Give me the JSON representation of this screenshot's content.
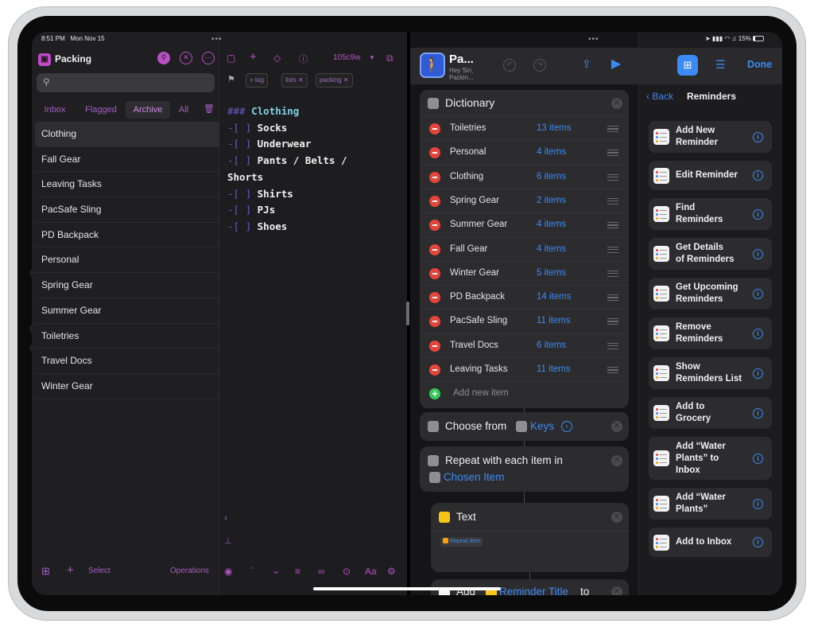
{
  "status": {
    "time": "8:51 PM",
    "date": "Mon Nov 15",
    "battery": "15%"
  },
  "drafts": {
    "workspace_title": "Packing",
    "search": {
      "placeholder": ""
    },
    "tabs": [
      {
        "label": "Inbox",
        "active": false
      },
      {
        "label": "Flagged",
        "active": false
      },
      {
        "label": "Archive",
        "active": true
      },
      {
        "label": "All",
        "active": false
      }
    ],
    "list_items": [
      "Clothing",
      "Fall Gear",
      "Leaving Tasks",
      "PacSafe Sling",
      "PD Backpack",
      "Personal",
      "Spring Gear",
      "Summer Gear",
      "Toiletries",
      "Travel Docs",
      "Winter Gear"
    ],
    "footer": {
      "select": "Select",
      "operations": "Operations"
    },
    "editor": {
      "version": "105c9w",
      "tags": {
        "add": "+ tag",
        "lists": "lists ✕",
        "packing": "packing ✕"
      },
      "heading_marker": "###",
      "heading": "Clothing",
      "checkbox": "[ ]",
      "items": [
        "Socks",
        "Underwear",
        "Pants / Belts /",
        "Shirts",
        "PJs",
        "Shoes"
      ],
      "continuation": "Shorts",
      "font_label": "Aa"
    }
  },
  "shortcuts": {
    "name": "Pa...",
    "subtitle_line1": "Hey Siri,",
    "subtitle_line2": "Packin...",
    "dictionary": {
      "title": "Dictionary",
      "rows": [
        {
          "key": "Toiletries",
          "value": "13 items"
        },
        {
          "key": "Personal",
          "value": "4 items"
        },
        {
          "key": "Clothing",
          "value": "6 items"
        },
        {
          "key": "Spring Gear",
          "value": "2 items"
        },
        {
          "key": "Summer Gear",
          "value": "4 items"
        },
        {
          "key": "Fall Gear",
          "value": "4 items"
        },
        {
          "key": "Winter Gear",
          "value": "5 items"
        },
        {
          "key": "PD Backpack",
          "value": "14 items"
        },
        {
          "key": "PacSafe Sling",
          "value": "11 items"
        },
        {
          "key": "Travel Docs",
          "value": "6 items"
        },
        {
          "key": "Leaving Tasks",
          "value": "11 items"
        }
      ],
      "add_new": "Add new item"
    },
    "choose": {
      "label": "Choose from",
      "token": "Keys"
    },
    "repeat": {
      "label": "Repeat with each item in",
      "token": "Chosen Item"
    },
    "text_action": {
      "title": "Text",
      "token": "Repeat Item"
    },
    "add_action": {
      "label": "Add",
      "token": "Reminder Title",
      "to": "to"
    },
    "panel": {
      "done": "Done",
      "back": "Back",
      "title": "Reminders",
      "actions": [
        [
          "Add New",
          "Reminder"
        ],
        [
          "Edit Reminder"
        ],
        [
          "Find",
          "Reminders"
        ],
        [
          "Get Details",
          "of Reminders"
        ],
        [
          "Get Upcoming",
          "Reminders"
        ],
        [
          "Remove",
          "Reminders"
        ],
        [
          "Show",
          "Reminders List"
        ],
        [
          "Add to",
          "Grocery"
        ],
        [
          "Add “Water",
          "Plants” to",
          "Inbox"
        ],
        [
          "Add “Water",
          "Plants”"
        ],
        [
          "Add to Inbox"
        ]
      ]
    }
  },
  "colors": {
    "drafts_accent": "#b84fc4",
    "shortcuts_accent": "#3b8af5",
    "heading": "#7fd3e6",
    "remove_red": "#e5443a",
    "add_green": "#34c759"
  },
  "icons": {
    "workspace": "briefcase-icon",
    "search": "magnifier-icon",
    "app": "hiker-icon",
    "play": "play-icon",
    "share": "share-icon"
  }
}
